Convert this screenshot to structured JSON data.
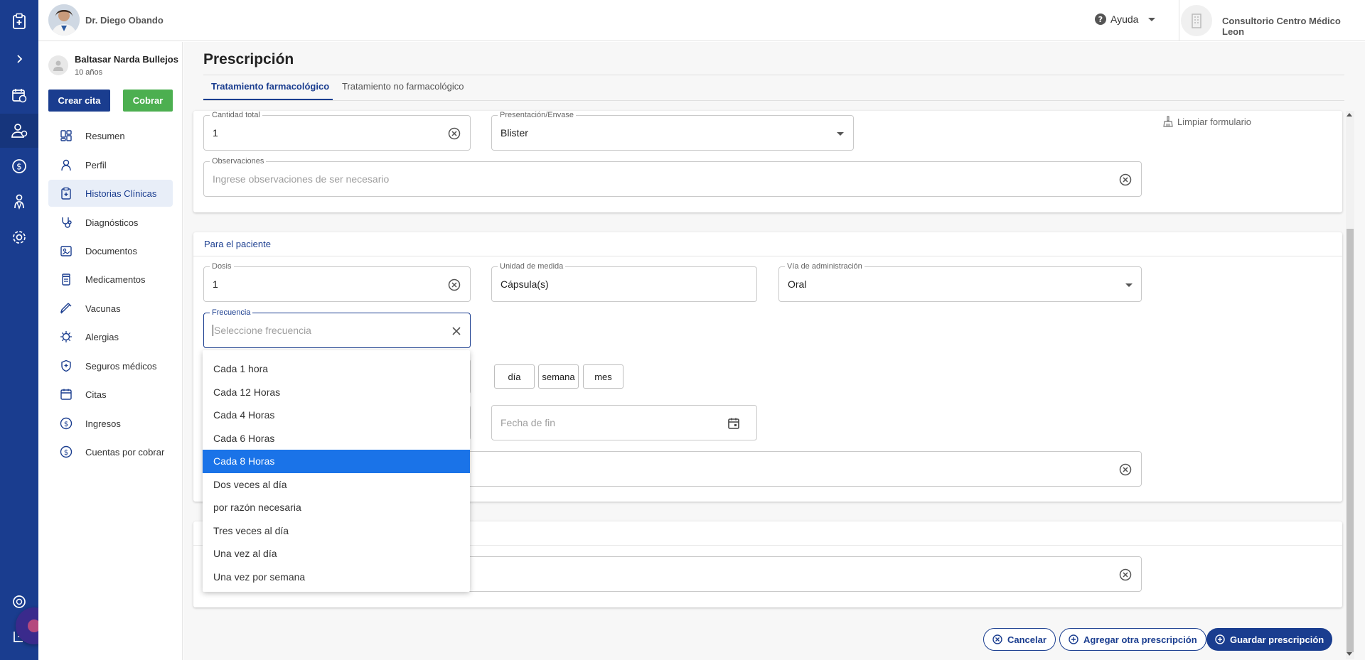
{
  "header": {
    "doctor_name": "Dr. Diego Obando",
    "help_label": "Ayuda",
    "clinic_name": "Consultorio Centro Médico Leon"
  },
  "patient": {
    "name": "Baltasar Narda Bullejos",
    "age": "10 años"
  },
  "actions": {
    "create_appointment": "Crear cita",
    "charge": "Cobrar"
  },
  "nav": {
    "items": [
      {
        "label": "Resumen",
        "icon": "summary-icon"
      },
      {
        "label": "Perfil",
        "icon": "profile-icon"
      },
      {
        "label": "Historias Clínicas",
        "icon": "medical-records-icon"
      },
      {
        "label": "Diagnósticos",
        "icon": "stethoscope-icon"
      },
      {
        "label": "Documentos",
        "icon": "documents-icon"
      },
      {
        "label": "Medicamentos",
        "icon": "medication-icon"
      },
      {
        "label": "Vacunas",
        "icon": "syringe-icon"
      },
      {
        "label": "Alergias",
        "icon": "allergy-icon"
      },
      {
        "label": "Seguros médicos",
        "icon": "insurance-icon"
      },
      {
        "label": "Citas",
        "icon": "calendar-icon"
      },
      {
        "label": "Ingresos",
        "icon": "income-icon"
      },
      {
        "label": "Cuentas por cobrar",
        "icon": "receivable-icon"
      }
    ],
    "active": "Historias Clínicas"
  },
  "page": {
    "title": "Prescripción",
    "tabs": [
      "Tratamiento farmacológico",
      "Tratamiento no farmacológico"
    ],
    "clear_form": "Limpiar formulario"
  },
  "form": {
    "quantity": {
      "label": "Cantidad total",
      "value": "1"
    },
    "presentation": {
      "label": "Presentación/Envase",
      "value": "Blister"
    },
    "observations": {
      "label": "Observaciones",
      "placeholder": "Ingrese observaciones de ser necesario"
    },
    "patient_section": "Para el paciente",
    "dose": {
      "label": "Dosis",
      "value": "1"
    },
    "unit": {
      "label": "Unidad de medida",
      "value": "Cápsula(s)"
    },
    "route": {
      "label": "Vía de administración",
      "value": "Oral"
    },
    "frequency": {
      "label": "Frecuencia",
      "placeholder": "Seleccione frecuencia"
    },
    "duration_units": [
      "día",
      "semana",
      "mes"
    ],
    "end_date": {
      "placeholder": "Fecha de fin"
    }
  },
  "frequency_options": [
    "Cada 1 hora",
    "Cada 12 Horas",
    "Cada 4 Horas",
    "Cada 6 Horas",
    "Cada 8 Horas",
    "Dos veces al día",
    "por razón necesaria",
    "Tres veces al día",
    "Una vez al día",
    "Una vez por semana"
  ],
  "frequency_highlighted": "Cada 8 Horas",
  "footer": {
    "cancel": "Cancelar",
    "add_another": "Agregar otra prescripción",
    "save": "Guardar prescripción"
  },
  "colors": {
    "primary": "#1a3d8f",
    "success": "#4caf50",
    "highlight": "#1a73e8"
  }
}
